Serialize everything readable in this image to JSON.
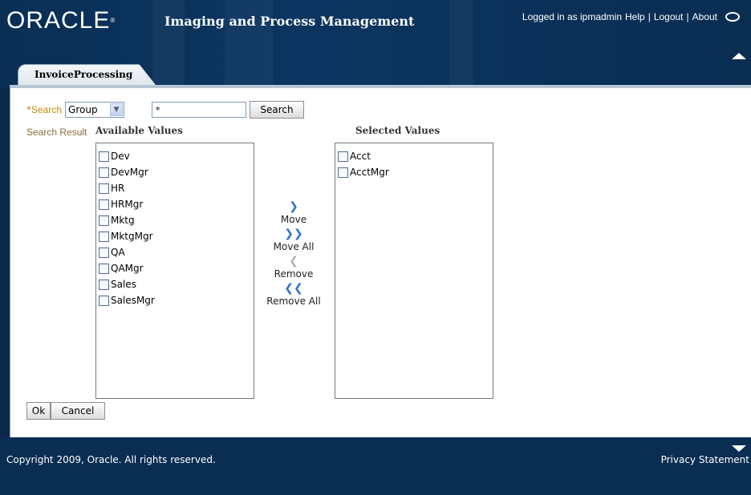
{
  "header": {
    "logo_text": "ORACLE",
    "app_title": "Imaging and Process Management",
    "logged_in": "Logged in as ipmadmin",
    "help": "Help",
    "logout": "Logout",
    "about": "About",
    "separator": "|"
  },
  "tab": {
    "label": "InvoiceProcessing"
  },
  "search": {
    "required_marker": "*",
    "label": "Search",
    "type_value": "Group",
    "query_value": "*",
    "button_label": "Search"
  },
  "results": {
    "label": "Search Result",
    "available_title": "Available Values",
    "selected_title": "Selected Values",
    "available": [
      "Dev",
      "DevMgr",
      "HR",
      "HRMgr",
      "Mktg",
      "MktgMgr",
      "QA",
      "QAMgr",
      "Sales",
      "SalesMgr"
    ],
    "selected": [
      "Acct",
      "AcctMgr"
    ]
  },
  "shuttle": {
    "move": "Move",
    "move_all": "Move All",
    "remove": "Remove",
    "remove_all": "Remove All"
  },
  "buttons": {
    "ok": "Ok",
    "cancel": "Cancel"
  },
  "footer": {
    "copyright": "Copyright 2009, Oracle. All rights reserved.",
    "privacy": "Privacy Statement"
  }
}
